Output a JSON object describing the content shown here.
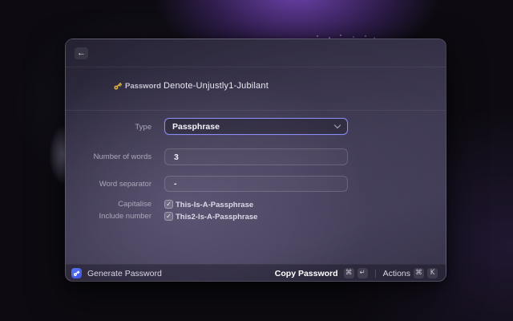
{
  "colors": {
    "accent_focus": "#8a8df0",
    "key_gold": "#e0b23e",
    "app_icon_blue": "#4a63ef",
    "glow_purple": "#5b3a8c",
    "window_bg": "#3a354d"
  },
  "header": {
    "back_arrow": "←",
    "password_label": "Password",
    "password_value": "Denote-Unjustly1-Jubilant"
  },
  "form": {
    "type": {
      "label": "Type",
      "value": "Passphrase"
    },
    "number_of_words": {
      "label": "Number of words",
      "value": "3"
    },
    "word_separator": {
      "label": "Word separator",
      "value": "-"
    },
    "capitalise": {
      "label": "Capitalise",
      "checked": true,
      "check_glyph": "✓",
      "text": "This-Is-A-Passphrase"
    },
    "include_number": {
      "label": "Include number",
      "checked": true,
      "check_glyph": "✓",
      "text": "This2-Is-A-Passphrase"
    }
  },
  "footer": {
    "app_label": "Generate Password",
    "primary": {
      "label": "Copy Password",
      "key1": "⌘",
      "key2": "↵"
    },
    "secondary": {
      "label": "Actions",
      "key1": "⌘",
      "key2": "K"
    }
  }
}
